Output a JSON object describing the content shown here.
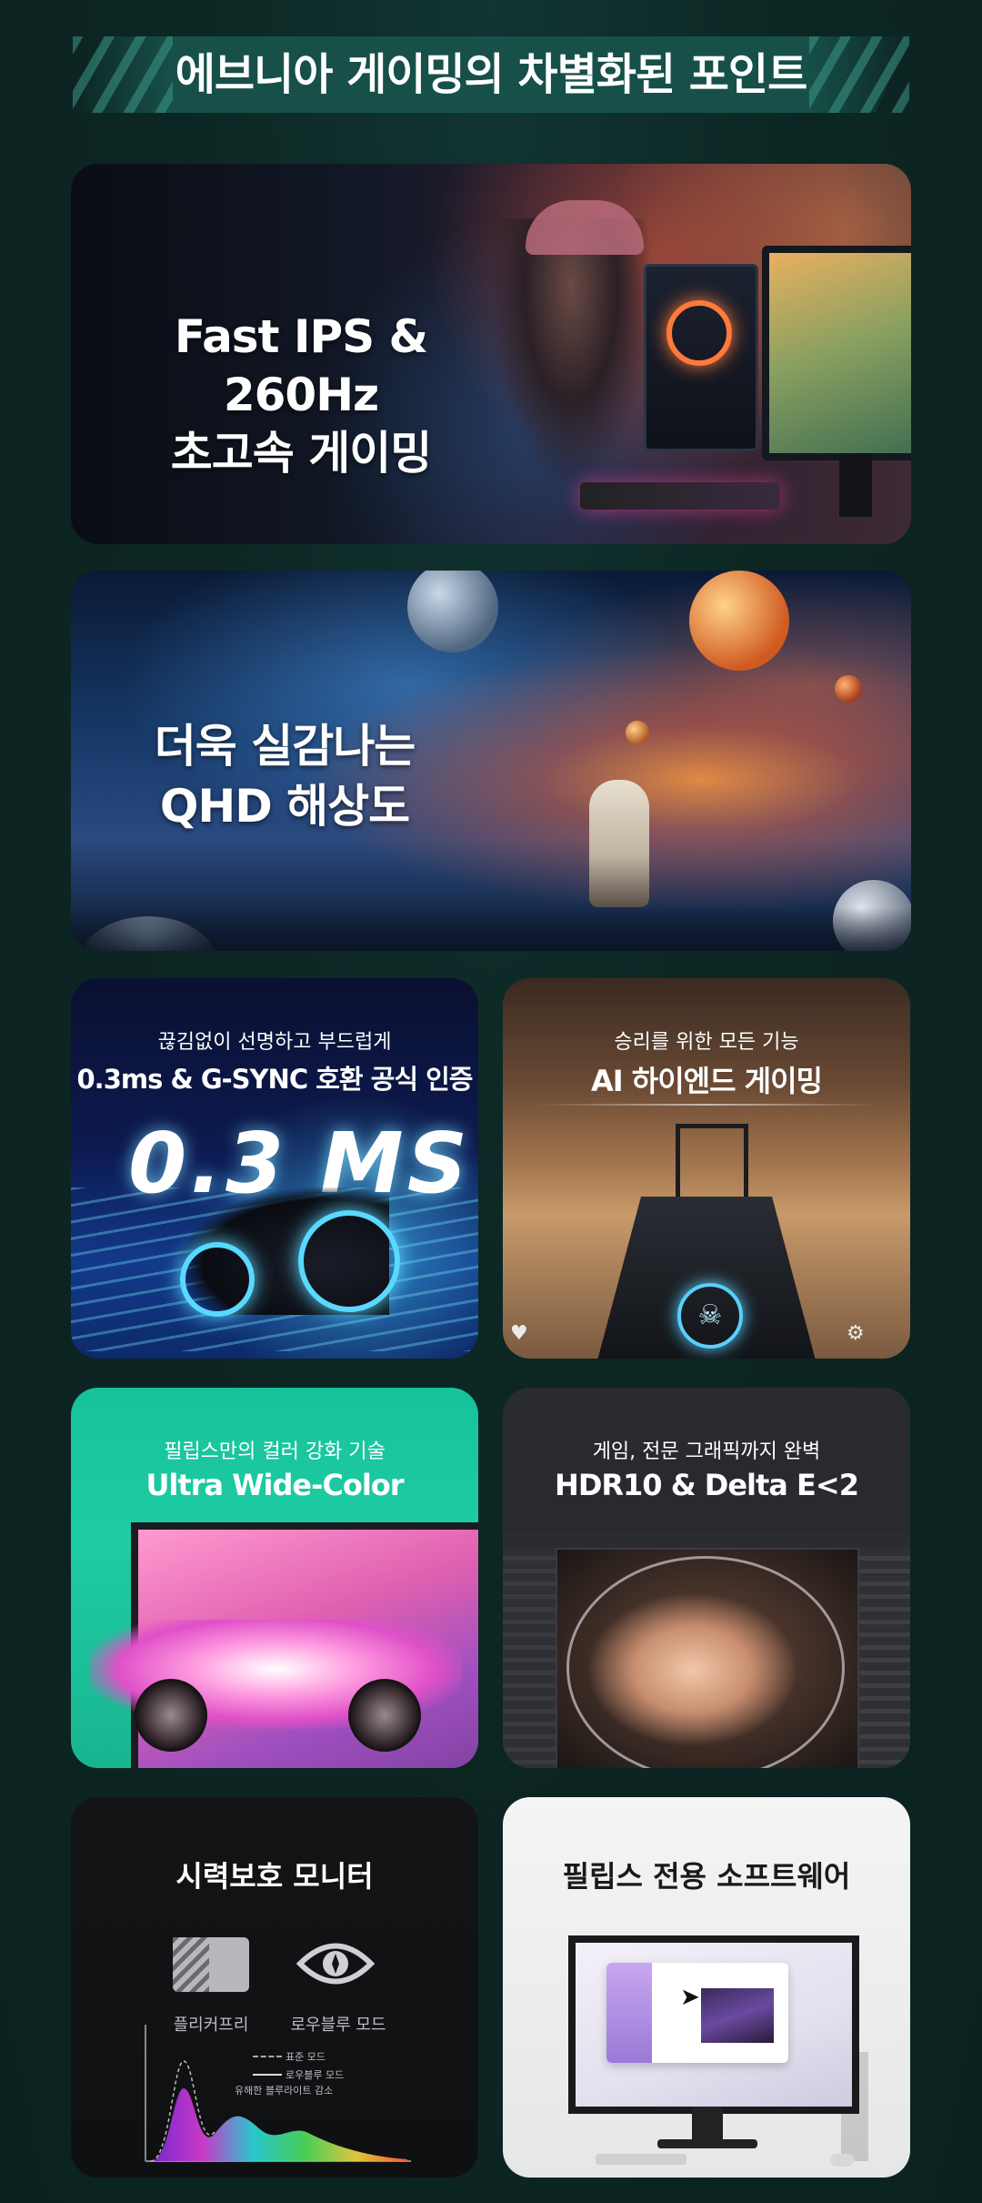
{
  "header": {
    "title": "에브니아 게이밍의 차별화된 포인트"
  },
  "cards": {
    "fast": {
      "line1": "Fast IPS & 260Hz",
      "line2": "초고속 게이밍"
    },
    "qhd": {
      "line1": "더욱 실감나는",
      "line2": "QHD 해상도"
    },
    "gsync": {
      "sub": "끊김없이 선명하고 부드럽게",
      "main": "0.3ms & G-SYNC 호환 공식 인증",
      "big": "0.3 MS"
    },
    "ai": {
      "sub": "승리를 위한 모든 기능",
      "main": "AI 하이엔드 게이밍"
    },
    "color": {
      "sub": "필립스만의 컬러 강화 기술",
      "main": "Ultra Wide-Color"
    },
    "hdr": {
      "sub": "게임, 전문 그래픽까지 완벽",
      "main": "HDR10 & Delta E<2"
    },
    "eye": {
      "title": "시력보호 모니터",
      "flicker_label": "플리커프리",
      "lowblue_label": "로우블루 모드",
      "legend_standard": "표준 모드",
      "legend_lowblue": "로우블루 모드",
      "harmful_label": "유해한 블루라이트 감소"
    },
    "software": {
      "title": "필립스 전용 소프트웨어"
    }
  },
  "colors": {
    "background": "#0c2623",
    "header_ribbon": "#175049",
    "color_card": "#1ecca4"
  },
  "icons": [
    "flicker-free-icon",
    "eye-icon",
    "skull-icon",
    "cursor-icon"
  ]
}
